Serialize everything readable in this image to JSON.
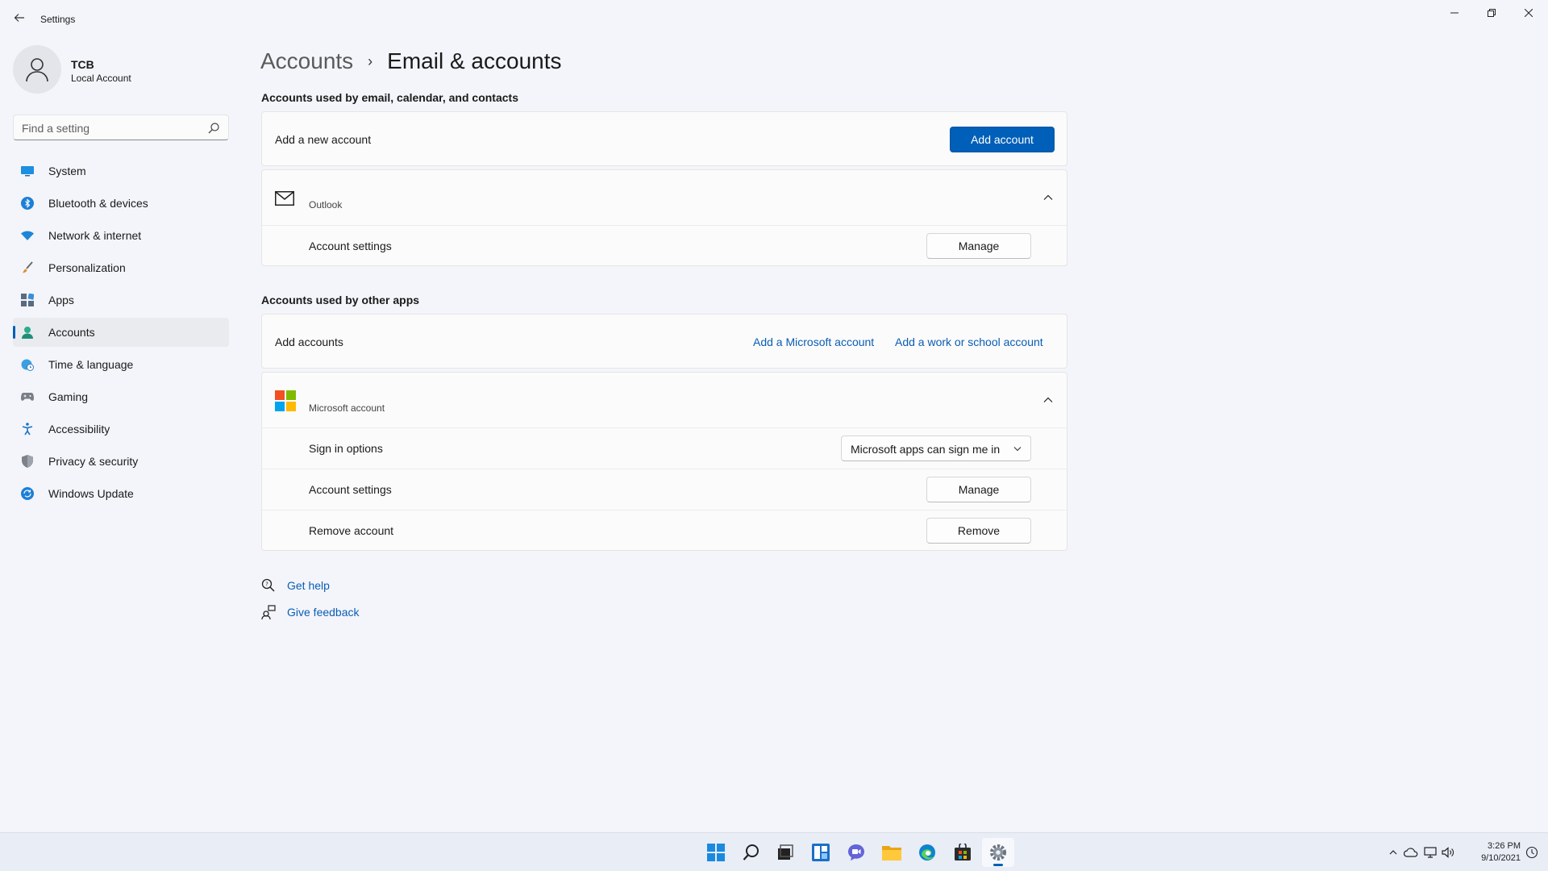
{
  "window": {
    "title": "Settings"
  },
  "profile": {
    "name": "TCB",
    "type": "Local Account"
  },
  "search": {
    "placeholder": "Find a setting"
  },
  "nav": {
    "items": [
      {
        "label": "System",
        "icon": "monitor-icon"
      },
      {
        "label": "Bluetooth & devices",
        "icon": "bluetooth-icon"
      },
      {
        "label": "Network & internet",
        "icon": "wifi-icon"
      },
      {
        "label": "Personalization",
        "icon": "brush-icon"
      },
      {
        "label": "Apps",
        "icon": "apps-icon"
      },
      {
        "label": "Accounts",
        "icon": "person-icon",
        "active": true
      },
      {
        "label": "Time & language",
        "icon": "globe-clock-icon"
      },
      {
        "label": "Gaming",
        "icon": "gamepad-icon"
      },
      {
        "label": "Accessibility",
        "icon": "accessibility-icon"
      },
      {
        "label": "Privacy & security",
        "icon": "shield-icon"
      },
      {
        "label": "Windows Update",
        "icon": "update-icon"
      }
    ]
  },
  "breadcrumb": {
    "parent": "Accounts",
    "separator": "›",
    "current": "Email & accounts"
  },
  "email_section": {
    "title": "Accounts used by email, calendar, and contacts",
    "add_row_label": "Add a new account",
    "add_button": "Add account",
    "outlook": {
      "name": "Outlook",
      "settings_label": "Account settings",
      "manage_button": "Manage"
    }
  },
  "other_section": {
    "title": "Accounts used by other apps",
    "add_row_label": "Add accounts",
    "add_ms_link": "Add a Microsoft account",
    "add_work_link": "Add a work or school account",
    "microsoft": {
      "name": "Microsoft account",
      "sign_in_label": "Sign in options",
      "sign_in_value": "Microsoft apps can sign me in",
      "settings_label": "Account settings",
      "manage_button": "Manage",
      "remove_label": "Remove account",
      "remove_button": "Remove"
    }
  },
  "help": {
    "get_help": "Get help",
    "feedback": "Give feedback"
  },
  "taskbar": {
    "apps": [
      "start-icon",
      "search-icon",
      "task-view-icon",
      "widgets-icon",
      "chat-icon",
      "file-explorer-icon",
      "edge-icon",
      "store-icon",
      "settings-icon"
    ],
    "time": "3:26 PM",
    "date": "9/10/2021"
  },
  "colors": {
    "accent": "#005fb8",
    "link": "#0a5db5",
    "background": "#f3f5fa",
    "card": "#fbfbfb"
  }
}
